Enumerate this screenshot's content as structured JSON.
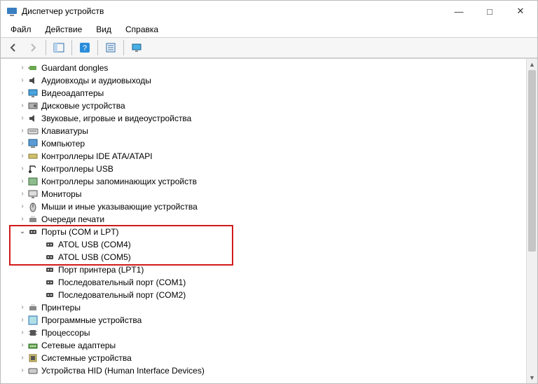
{
  "window": {
    "title": "Диспетчер устройств",
    "buttons": {
      "minimize": "—",
      "maximize": "□",
      "close": "✕"
    }
  },
  "menubar": {
    "file": "Файл",
    "action": "Действие",
    "view": "Вид",
    "help": "Справка"
  },
  "toolbar": {
    "back": "back-icon",
    "forward": "forward-icon",
    "showhide": "panel-icon",
    "help": "help-icon",
    "properties": "properties-icon",
    "monitor": "monitor-icon"
  },
  "tree": {
    "nodes": [
      {
        "label": "Guardant dongles",
        "icon": "dongle",
        "expandable": true,
        "expanded": false
      },
      {
        "label": "Аудиовходы и аудиовыходы",
        "icon": "audio",
        "expandable": true,
        "expanded": false
      },
      {
        "label": "Видеоадаптеры",
        "icon": "display",
        "expandable": true,
        "expanded": false
      },
      {
        "label": "Дисковые устройства",
        "icon": "disk",
        "expandable": true,
        "expanded": false
      },
      {
        "label": "Звуковые, игровые и видеоустройства",
        "icon": "audio",
        "expandable": true,
        "expanded": false
      },
      {
        "label": "Клавиатуры",
        "icon": "keyboard",
        "expandable": true,
        "expanded": false
      },
      {
        "label": "Компьютер",
        "icon": "computer",
        "expandable": true,
        "expanded": false
      },
      {
        "label": "Контроллеры IDE ATA/ATAPI",
        "icon": "ide",
        "expandable": true,
        "expanded": false
      },
      {
        "label": "Контроллеры USB",
        "icon": "usb",
        "expandable": true,
        "expanded": false
      },
      {
        "label": "Контроллеры запоминающих устройств",
        "icon": "storage",
        "expandable": true,
        "expanded": false
      },
      {
        "label": "Мониторы",
        "icon": "monitor",
        "expandable": true,
        "expanded": false
      },
      {
        "label": "Мыши и иные указывающие устройства",
        "icon": "mouse",
        "expandable": true,
        "expanded": false
      },
      {
        "label": "Очереди печати",
        "icon": "printqueue",
        "expandable": true,
        "expanded": false
      },
      {
        "label": "Порты (COM и LPT)",
        "icon": "port",
        "expandable": true,
        "expanded": true,
        "children": [
          {
            "label": "ATOL USB (COM4)",
            "icon": "port"
          },
          {
            "label": "ATOL USB (COM5)",
            "icon": "port"
          },
          {
            "label": "Порт принтера (LPT1)",
            "icon": "port"
          },
          {
            "label": "Последовательный порт (COM1)",
            "icon": "port"
          },
          {
            "label": "Последовательный порт (COM2)",
            "icon": "port"
          }
        ]
      },
      {
        "label": "Принтеры",
        "icon": "printer",
        "expandable": true,
        "expanded": false
      },
      {
        "label": "Программные устройства",
        "icon": "software",
        "expandable": true,
        "expanded": false
      },
      {
        "label": "Процессоры",
        "icon": "cpu",
        "expandable": true,
        "expanded": false
      },
      {
        "label": "Сетевые адаптеры",
        "icon": "network",
        "expandable": true,
        "expanded": false
      },
      {
        "label": "Системные устройства",
        "icon": "system",
        "expandable": true,
        "expanded": false
      },
      {
        "label": "Устройства HID (Human Interface Devices)",
        "icon": "hid",
        "expandable": true,
        "expanded": false
      }
    ]
  },
  "highlight": {
    "startNode": 13,
    "childCount": 2
  }
}
